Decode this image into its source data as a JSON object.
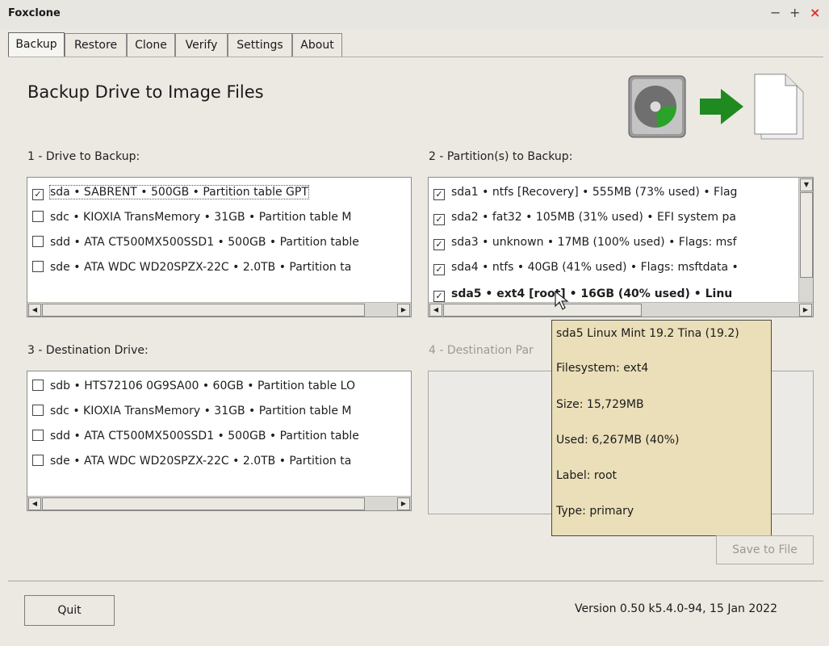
{
  "window": {
    "title": "Foxclone",
    "minimize": "−",
    "maximize": "+",
    "close": "×"
  },
  "tabs": [
    "Backup",
    "Restore",
    "Clone",
    "Verify",
    "Settings",
    "About"
  ],
  "active_tab": "Backup",
  "page_title": "Backup Drive to Image Files",
  "hero_icons": [
    "hard-drive-icon",
    "arrow-right-icon",
    "document-icon"
  ],
  "sections": {
    "drive_to_backup": {
      "label": "1 - Drive to Backup:",
      "items": [
        {
          "text": "sda • SABRENT  • 500GB • Partition table GPT",
          "checked": true
        },
        {
          "text": "sdc • KIOXIA TransMemory • 31GB • Partition table M",
          "checked": false
        },
        {
          "text": "sdd • ATA CT500MX500SSD1 • 500GB • Partition table",
          "checked": false
        },
        {
          "text": "sde • ATA WDC WD20SPZX-22C • 2.0TB • Partition ta",
          "checked": false
        }
      ]
    },
    "partitions_to_backup": {
      "label": "2 - Partition(s) to Backup:",
      "items": [
        {
          "text": "sda1 • ntfs [Recovery] • 555MB (73% used) • Flag",
          "checked": true
        },
        {
          "text": "sda2 • fat32 • 105MB (31% used) • EFI system pa",
          "checked": true
        },
        {
          "text": "sda3 • unknown • 17MB (100% used) • Flags: msf",
          "checked": true
        },
        {
          "text": "sda4 • ntfs • 40GB (41% used) • Flags: msftdata •",
          "checked": true
        },
        {
          "text": "sda5 • ext4 [root] • 16GB (40% used) • Linu",
          "checked": true
        }
      ]
    },
    "destination_drive": {
      "label": "3 - Destination Drive:",
      "items": [
        {
          "text": "sdb • HTS72106 0G9SA00 • 60GB • Partition table LO",
          "checked": false
        },
        {
          "text": "sdc • KIOXIA TransMemory • 31GB • Partition table M",
          "checked": false
        },
        {
          "text": "sdd • ATA CT500MX500SSD1 • 500GB • Partition table",
          "checked": false
        },
        {
          "text": "sde • ATA WDC WD20SPZX-22C • 2.0TB • Partition ta",
          "checked": false
        }
      ]
    },
    "destination_partition": {
      "label": "4 - Destination Par"
    }
  },
  "tooltip": {
    "lines": [
      "sda5 Linux Mint 19.2 Tina (19.2)",
      "Filesystem: ext4",
      "Size: 15,729MB",
      "Used: 6,267MB (40%)",
      "Label: root",
      "Type: primary"
    ]
  },
  "buttons": {
    "save_to_file": "Save to File",
    "quit": "Quit"
  },
  "version": "Version 0.50 k5.4.0-94, 15 Jan 2022",
  "colors": {
    "background": "#ece9e3",
    "tooltip_bg": "#eadfb9",
    "arrow_green": "#1f8a1f",
    "close_red": "#e0302a"
  }
}
